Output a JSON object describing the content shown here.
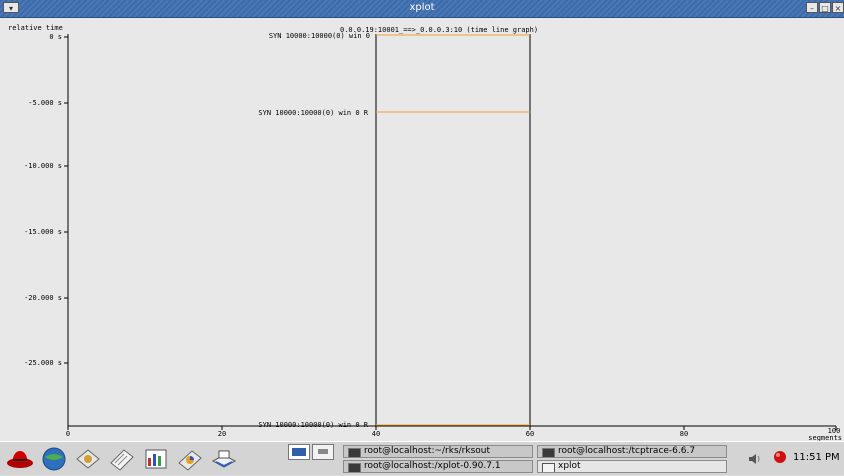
{
  "window": {
    "title": "xplot"
  },
  "plot": {
    "title": "0.0.0.19:10001_==>_0.0.0.3:10 (time line graph)",
    "y_axis_title": "relative time",
    "x_axis_title": "segments",
    "y_ticks": [
      "0 s",
      "-5.000 s",
      "-10.000 s",
      "-15.000 s",
      "-20.000 s",
      "-25.000 s"
    ],
    "x_ticks": [
      "0",
      "20",
      "40",
      "60",
      "80",
      "100"
    ],
    "event_labels": [
      "SYN 10000:10000(0) win 0",
      "SYN 10000:10000(0) win 0 R",
      "SYN 10000:10000(0) win 0 R"
    ],
    "colors": {
      "axis": "#000000",
      "event_line": "#f0a030",
      "background": "#e8e8e8"
    }
  },
  "taskbar": {
    "launchers": [
      "redhat-icon",
      "browser-icon",
      "mail-icon",
      "writer-icon",
      "spreadsheet-icon",
      "presentation-icon",
      "print-icon"
    ],
    "tasks": [
      {
        "label": "root@localhost:~/rks/rksout",
        "active": false
      },
      {
        "label": "root@localhost:/tcptrace-6.6.7",
        "active": false
      },
      {
        "label": "root@localhost:/xplot-0.90.7.1",
        "active": false
      },
      {
        "label": "xplot",
        "active": true
      }
    ],
    "clock": "11:51 PM"
  }
}
